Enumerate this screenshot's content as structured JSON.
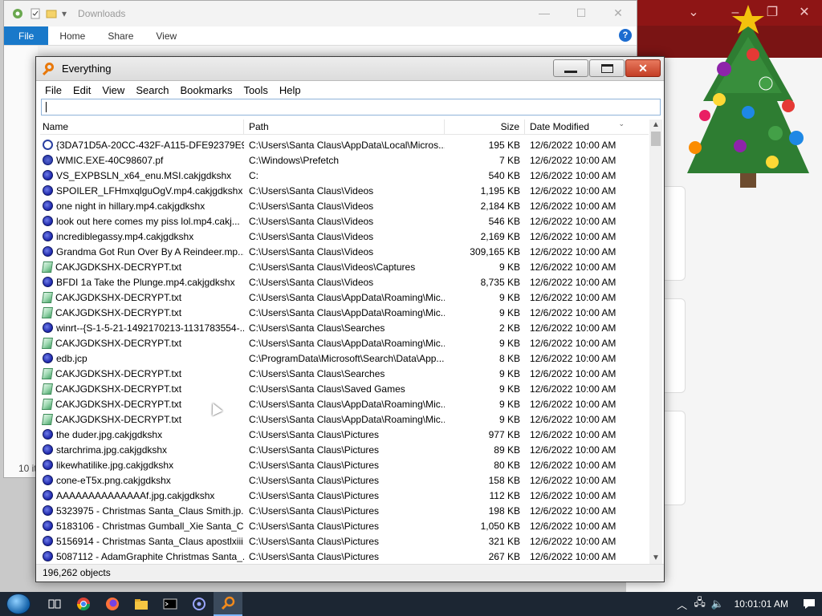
{
  "explorer": {
    "title": "Downloads",
    "ribbon_tabs": [
      "File",
      "Home",
      "Share",
      "View"
    ],
    "status_text": "10 it"
  },
  "everything": {
    "title": "Everything",
    "menu": [
      "File",
      "Edit",
      "View",
      "Search",
      "Bookmarks",
      "Tools",
      "Help"
    ],
    "search_value": "",
    "columns": {
      "name": "Name",
      "path": "Path",
      "size": "Size",
      "date": "Date Modified"
    },
    "rows": [
      {
        "icon": "gear",
        "name": "{3DA71D5A-20CC-432F-A115-DFE92379E9...",
        "path": "C:\\Users\\Santa Claus\\AppData\\Local\\Micros...",
        "size": "195 KB",
        "date": "12/6/2022 10:00 AM"
      },
      {
        "icon": "wrench",
        "name": "WMIC.EXE-40C98607.pf",
        "path": "C:\\Windows\\Prefetch",
        "size": "7 KB",
        "date": "12/6/2022 10:00 AM"
      },
      {
        "icon": "media",
        "name": "VS_EXPBSLN_x64_enu.MSI.cakjgdkshx",
        "path": "C:",
        "size": "540 KB",
        "date": "12/6/2022 10:00 AM"
      },
      {
        "icon": "media",
        "name": "SPOILER_LFHmxqlguOgV.mp4.cakjgdkshx",
        "path": "C:\\Users\\Santa Claus\\Videos",
        "size": "1,195 KB",
        "date": "12/6/2022 10:00 AM"
      },
      {
        "icon": "media",
        "name": "one night in hillary.mp4.cakjgdkshx",
        "path": "C:\\Users\\Santa Claus\\Videos",
        "size": "2,184 KB",
        "date": "12/6/2022 10:00 AM"
      },
      {
        "icon": "media",
        "name": "look out here comes my piss lol.mp4.cakj...",
        "path": "C:\\Users\\Santa Claus\\Videos",
        "size": "546 KB",
        "date": "12/6/2022 10:00 AM"
      },
      {
        "icon": "media",
        "name": "incrediblegassy.mp4.cakjgdkshx",
        "path": "C:\\Users\\Santa Claus\\Videos",
        "size": "2,169 KB",
        "date": "12/6/2022 10:00 AM"
      },
      {
        "icon": "media",
        "name": "Grandma Got Run Over By A Reindeer.mp...",
        "path": "C:\\Users\\Santa Claus\\Videos",
        "size": "309,165 KB",
        "date": "12/6/2022 10:00 AM"
      },
      {
        "icon": "txt",
        "name": "CAKJGDKSHX-DECRYPT.txt",
        "path": "C:\\Users\\Santa Claus\\Videos\\Captures",
        "size": "9 KB",
        "date": "12/6/2022 10:00 AM"
      },
      {
        "icon": "media",
        "name": "BFDI 1a Take the Plunge.mp4.cakjgdkshx",
        "path": "C:\\Users\\Santa Claus\\Videos",
        "size": "8,735 KB",
        "date": "12/6/2022 10:00 AM"
      },
      {
        "icon": "txt",
        "name": "CAKJGDKSHX-DECRYPT.txt",
        "path": "C:\\Users\\Santa Claus\\AppData\\Roaming\\Mic...",
        "size": "9 KB",
        "date": "12/6/2022 10:00 AM"
      },
      {
        "icon": "txt",
        "name": "CAKJGDKSHX-DECRYPT.txt",
        "path": "C:\\Users\\Santa Claus\\AppData\\Roaming\\Mic...",
        "size": "9 KB",
        "date": "12/6/2022 10:00 AM"
      },
      {
        "icon": "media",
        "name": "winrt--{S-1-5-21-1492170213-1131783554-...",
        "path": "C:\\Users\\Santa Claus\\Searches",
        "size": "2 KB",
        "date": "12/6/2022 10:00 AM"
      },
      {
        "icon": "txt",
        "name": "CAKJGDKSHX-DECRYPT.txt",
        "path": "C:\\Users\\Santa Claus\\AppData\\Roaming\\Mic...",
        "size": "9 KB",
        "date": "12/6/2022 10:00 AM"
      },
      {
        "icon": "media",
        "name": "edb.jcp",
        "path": "C:\\ProgramData\\Microsoft\\Search\\Data\\App...",
        "size": "8 KB",
        "date": "12/6/2022 10:00 AM"
      },
      {
        "icon": "txt",
        "name": "CAKJGDKSHX-DECRYPT.txt",
        "path": "C:\\Users\\Santa Claus\\Searches",
        "size": "9 KB",
        "date": "12/6/2022 10:00 AM"
      },
      {
        "icon": "txt",
        "name": "CAKJGDKSHX-DECRYPT.txt",
        "path": "C:\\Users\\Santa Claus\\Saved Games",
        "size": "9 KB",
        "date": "12/6/2022 10:00 AM"
      },
      {
        "icon": "txt",
        "name": "CAKJGDKSHX-DECRYPT.txt",
        "path": "C:\\Users\\Santa Claus\\AppData\\Roaming\\Mic...",
        "size": "9 KB",
        "date": "12/6/2022 10:00 AM"
      },
      {
        "icon": "txt",
        "name": "CAKJGDKSHX-DECRYPT.txt",
        "path": "C:\\Users\\Santa Claus\\AppData\\Roaming\\Mic...",
        "size": "9 KB",
        "date": "12/6/2022 10:00 AM"
      },
      {
        "icon": "media",
        "name": "the duder.jpg.cakjgdkshx",
        "path": "C:\\Users\\Santa Claus\\Pictures",
        "size": "977 KB",
        "date": "12/6/2022 10:00 AM"
      },
      {
        "icon": "media",
        "name": "starchrima.jpg.cakjgdkshx",
        "path": "C:\\Users\\Santa Claus\\Pictures",
        "size": "89 KB",
        "date": "12/6/2022 10:00 AM"
      },
      {
        "icon": "media",
        "name": "likewhatilike.jpg.cakjgdkshx",
        "path": "C:\\Users\\Santa Claus\\Pictures",
        "size": "80 KB",
        "date": "12/6/2022 10:00 AM"
      },
      {
        "icon": "media",
        "name": "cone-eT5x.png.cakjgdkshx",
        "path": "C:\\Users\\Santa Claus\\Pictures",
        "size": "158 KB",
        "date": "12/6/2022 10:00 AM"
      },
      {
        "icon": "media",
        "name": "AAAAAAAAAAAAAAf.jpg.cakjgdkshx",
        "path": "C:\\Users\\Santa Claus\\Pictures",
        "size": "112 KB",
        "date": "12/6/2022 10:00 AM"
      },
      {
        "icon": "media",
        "name": "5323975 - Christmas Santa_Claus Smith.jp...",
        "path": "C:\\Users\\Santa Claus\\Pictures",
        "size": "198 KB",
        "date": "12/6/2022 10:00 AM"
      },
      {
        "icon": "media",
        "name": "5183106 - Christmas Gumball_Xie Santa_Cl...",
        "path": "C:\\Users\\Santa Claus\\Pictures",
        "size": "1,050 KB",
        "date": "12/6/2022 10:00 AM"
      },
      {
        "icon": "media",
        "name": "5156914 - Christmas Santa_Claus apostlxiii...",
        "path": "C:\\Users\\Santa Claus\\Pictures",
        "size": "321 KB",
        "date": "12/6/2022 10:00 AM"
      },
      {
        "icon": "media",
        "name": "5087112 - AdamGraphite Christmas Santa_...",
        "path": "C:\\Users\\Santa Claus\\Pictures",
        "size": "267 KB",
        "date": "12/6/2022 10:00 AM"
      }
    ],
    "status": "196,262 objects"
  },
  "taskbar": {
    "clock": "10:01:01 AM",
    "pinned": [
      "task-view-icon",
      "chrome-icon",
      "firefox-icon",
      "file-explorer-icon",
      "terminal-icon",
      "network-app-icon",
      "everything-search-icon"
    ]
  }
}
